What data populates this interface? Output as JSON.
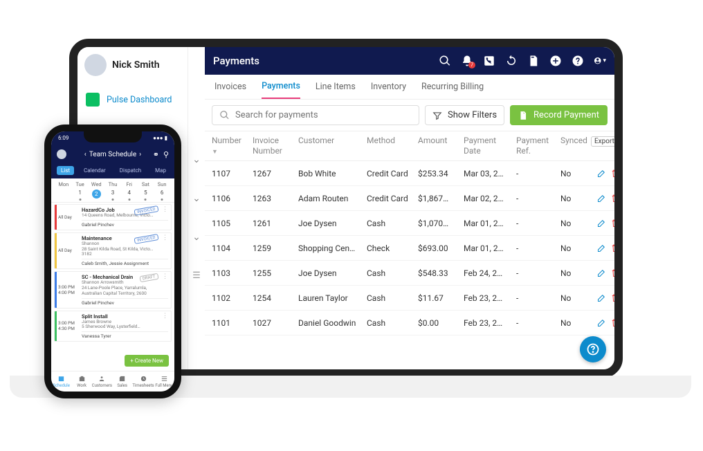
{
  "user": {
    "name": "Nick Smith"
  },
  "sidebar": {
    "pulse": "Pulse Dashboard"
  },
  "topbar": {
    "title": "Payments",
    "bell_badge": "7"
  },
  "tabs": [
    {
      "label": "Invoices"
    },
    {
      "label": "Payments"
    },
    {
      "label": "Line Items"
    },
    {
      "label": "Inventory"
    },
    {
      "label": "Recurring Billing"
    }
  ],
  "active_tab": 1,
  "search": {
    "placeholder": "Search for payments"
  },
  "filters": {
    "show": "Show Filters"
  },
  "record": {
    "label": "Record Payment"
  },
  "columns": {
    "number": "Number",
    "invoice": "Invoice Number",
    "customer": "Customer",
    "method": "Method",
    "amount": "Amount",
    "date": "Payment Date",
    "ref": "Payment Ref.",
    "synced": "Synced",
    "export": "Export"
  },
  "rows": [
    {
      "number": "1107",
      "invoice": "1267",
      "customer": "Bob White",
      "method": "Credit Card",
      "amount": "$253.34",
      "date": "Mar 03, 2…",
      "ref": "-",
      "synced": "No"
    },
    {
      "number": "1106",
      "invoice": "1263",
      "customer": "Adam Routen",
      "method": "Credit Card",
      "amount": "$1,867…",
      "date": "Mar 02, 2…",
      "ref": "-",
      "synced": "No"
    },
    {
      "number": "1105",
      "invoice": "1261",
      "customer": "Joe Dysen",
      "method": "Cash",
      "amount": "$1,070…",
      "date": "Mar 01, 2…",
      "ref": "-",
      "synced": "No"
    },
    {
      "number": "1104",
      "invoice": "1259",
      "customer": "Shopping Cen…",
      "method": "Check",
      "amount": "$693.00",
      "date": "Mar 01, 2…",
      "ref": "-",
      "synced": "No"
    },
    {
      "number": "1103",
      "invoice": "1255",
      "customer": "Joe Dysen",
      "method": "Cash",
      "amount": "$548.33",
      "date": "Feb 24, 2…",
      "ref": "-",
      "synced": "No"
    },
    {
      "number": "1102",
      "invoice": "1254",
      "customer": "Lauren Taylor",
      "method": "Cash",
      "amount": "$11.67",
      "date": "Feb 23, 2…",
      "ref": "-",
      "synced": "No"
    },
    {
      "number": "1101",
      "invoice": "1027",
      "customer": "Daniel Goodwin",
      "method": "Cash",
      "amount": "$0.00",
      "date": "Feb 23, 2…",
      "ref": "-",
      "synced": "No"
    }
  ],
  "phone": {
    "time": "6:09",
    "title": "Team Schedule",
    "viewtabs": [
      "List",
      "Calendar",
      "Dispatch",
      "Map"
    ],
    "days": [
      "Mon",
      "Tue",
      "Wed",
      "Thu",
      "Fri",
      "Sat",
      "Sun"
    ],
    "dates": [
      "1",
      "2",
      "3",
      "4",
      "5",
      "6"
    ],
    "selected_day_index": 1,
    "jobs": [
      {
        "stripe": "#e63b3b",
        "time": "All Day",
        "title": "HazardCo Job",
        "sub": "14 Queens Road, Melbourne, Victo…",
        "assignee": "Gabriel Pinchev",
        "stamp": "INVOICED",
        "stamp_style": "blue"
      },
      {
        "stripe": "#f0c542",
        "time": "All Day",
        "title": "Maintenance",
        "sub": "Shannon\n28 Saint Kilda Road, St Kilda, Victo…\n3182",
        "assignee": "Caleb Smith, Jessie Assignment",
        "stamp": "INVOICED",
        "stamp_style": "blue"
      },
      {
        "stripe": "#3d7de8",
        "time1": "3:00 PM",
        "time2": "4:00 PM",
        "title": "SC - Mechanical Drain",
        "sub": "Shannon Arrowsmith\n24 Lane-Poole Place, Yarralumla,\nAustralian Capital Territory, 2600",
        "assignee": "Gabriel Pinchev",
        "stamp": "DRAFT",
        "stamp_style": "gray"
      },
      {
        "stripe": "#3dbf62",
        "time1": "3:00 PM",
        "time2": "4:30 PM",
        "title": "Split Install",
        "sub": "James Browne\n5 Sherwood Way, Lysterfield…",
        "assignee": "Vanessa Tyrer"
      }
    ],
    "create": "+  Create New",
    "bottom": [
      "Schedule",
      "Work",
      "Customers",
      "Sales",
      "Timesheets",
      "Full Menu"
    ]
  }
}
